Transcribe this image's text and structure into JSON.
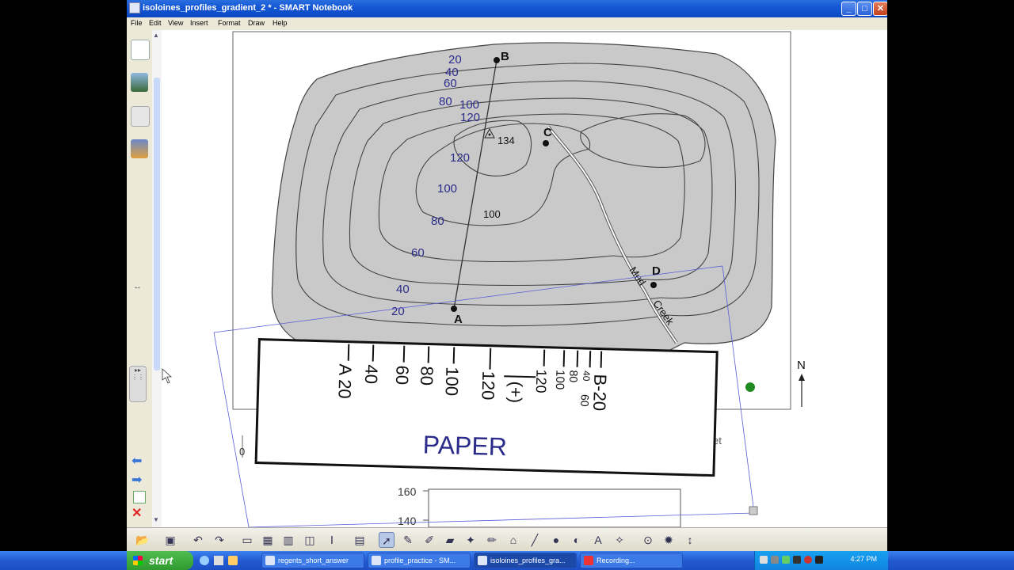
{
  "window": {
    "title": "isoloines_profiles_gradient_2 * - SMART Notebook",
    "minimize": "_",
    "maximize": "□",
    "close": "✕"
  },
  "menu": [
    "File",
    "Edit",
    "View",
    "Insert",
    "Format",
    "Draw",
    "Help"
  ],
  "map": {
    "contour_labels_left": [
      "20",
      "40",
      "60",
      "80",
      "100",
      "120",
      "120",
      "100",
      "80",
      "60",
      "40",
      "20"
    ],
    "point_B": "B",
    "point_A": "A",
    "point_C": "C",
    "point_D": "D",
    "peak": "134",
    "label_100": "100",
    "creek_1": "Mud",
    "creek_2": "Creek",
    "north": "N"
  },
  "paper": {
    "title": "PAPER",
    "marks": [
      "A 20",
      "40",
      "60",
      "80",
      "100",
      "120",
      "(+)",
      "120",
      "100",
      "80",
      "60",
      "40",
      "B-20"
    ]
  },
  "profile_axis": {
    "y160": "160",
    "y140": "140",
    "zero": "0",
    "feet_fragment": "et"
  },
  "taskbar": {
    "start": "start",
    "tasks": [
      "regents_short_answer",
      "profile_practice - SM...",
      "isoloines_profiles_gra...",
      "Recording..."
    ],
    "clock": "4:27 PM"
  },
  "colors": {
    "map_gray": "#c9c9c9",
    "contour": "#444444",
    "label_blue": "#2b2b8a",
    "selection": "#5b5bd6",
    "xp_blue": "#2258d0",
    "xp_green": "#35a535"
  }
}
